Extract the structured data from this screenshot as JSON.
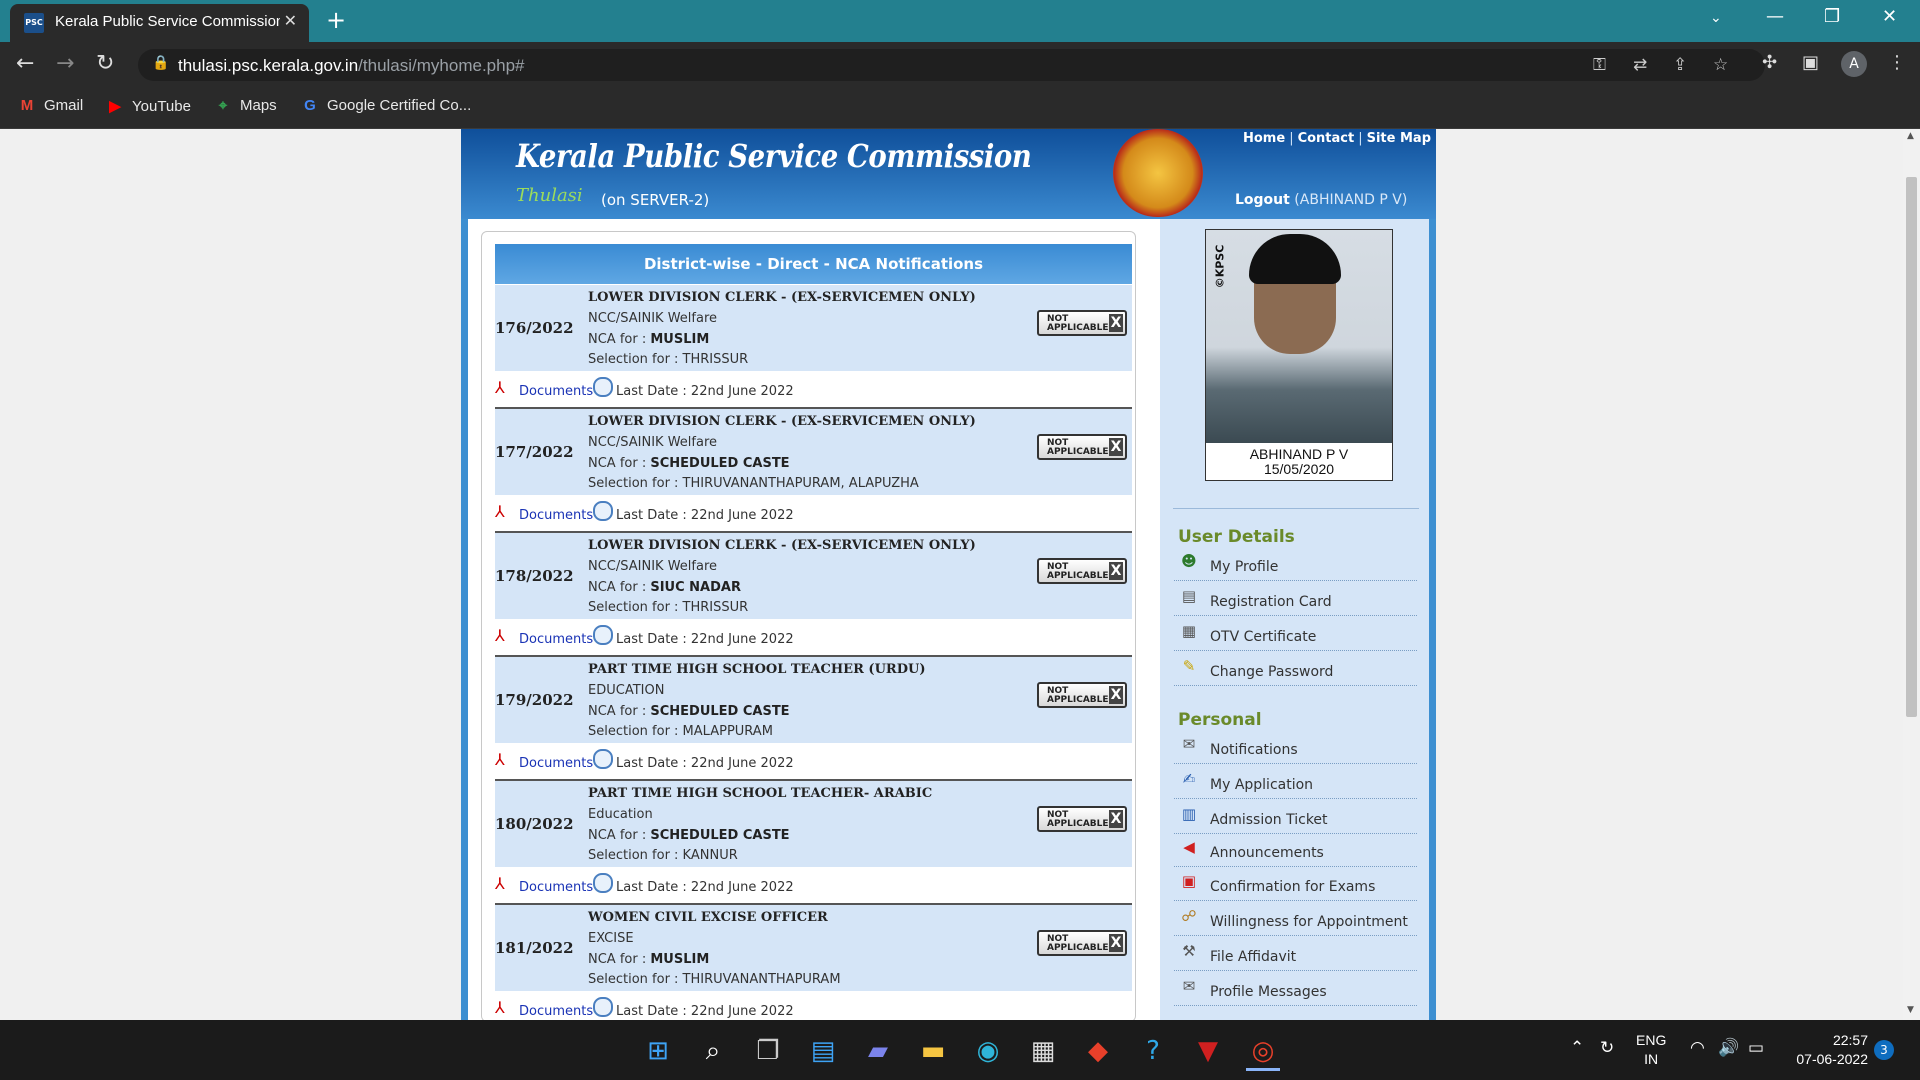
{
  "browser": {
    "tab_title": "Kerala Public Service Commission",
    "tab_favicon": "PSC",
    "url_domain": "thulasi.psc.kerala.gov.in",
    "url_path": "/thulasi/myhome.php#",
    "avatar_letter": "A",
    "bookmarks": [
      {
        "label": "Gmail",
        "icon": "gmail-icon"
      },
      {
        "label": "YouTube",
        "icon": "youtube-icon"
      },
      {
        "label": "Maps",
        "icon": "maps-icon"
      },
      {
        "label": "Google Certified Co...",
        "icon": "google-icon"
      }
    ]
  },
  "site": {
    "title": "Kerala Public Service Commission",
    "brand": "Thulasi",
    "server": "(on SERVER-2)",
    "links": [
      "Home",
      "Contact",
      "Site Map"
    ],
    "logout_label": "Logout",
    "logout_user": "(ABHINAND P V)"
  },
  "main": {
    "heading": "District-wise - Direct - NCA Notifications",
    "notifications": [
      {
        "number": "176/2022",
        "post": "LOWER DIVISION CLERK - (EX-SERVICEMEN ONLY)",
        "dept": "NCC/SAINIK Welfare",
        "nca_label": "NCA for : ",
        "nca": "MUSLIM",
        "selection": "Selection for : THRISSUR",
        "status1": "NOT",
        "status2": "APPLICABLE",
        "docs": "Documents",
        "last_date": "Last Date : 22nd June 2022"
      },
      {
        "number": "177/2022",
        "post": "LOWER DIVISION CLERK - (EX-SERVICEMEN ONLY)",
        "dept": "NCC/SAINIK Welfare",
        "nca_label": "NCA for : ",
        "nca": "SCHEDULED CASTE",
        "selection": "Selection for : THIRUVANANTHAPURAM, ALAPUZHA",
        "status1": "NOT",
        "status2": "APPLICABLE",
        "docs": "Documents",
        "last_date": "Last Date : 22nd June 2022"
      },
      {
        "number": "178/2022",
        "post": "LOWER DIVISION CLERK - (EX-SERVICEMEN ONLY)",
        "dept": "NCC/SAINIK Welfare",
        "nca_label": "NCA for : ",
        "nca": "SIUC NADAR",
        "selection": "Selection for : THRISSUR",
        "status1": "NOT",
        "status2": "APPLICABLE",
        "docs": "Documents",
        "last_date": "Last Date : 22nd June 2022"
      },
      {
        "number": "179/2022",
        "post": "PART TIME HIGH SCHOOL TEACHER (URDU)",
        "dept": "EDUCATION",
        "nca_label": "NCA for : ",
        "nca": "SCHEDULED CASTE",
        "selection": "Selection for : MALAPPURAM",
        "status1": "NOT",
        "status2": "APPLICABLE",
        "docs": "Documents",
        "last_date": "Last Date : 22nd June 2022"
      },
      {
        "number": "180/2022",
        "post": "PART TIME HIGH SCHOOL TEACHER- ARABIC",
        "dept": "Education",
        "nca_label": "NCA for : ",
        "nca": "SCHEDULED CASTE",
        "selection": "Selection for : KANNUR",
        "status1": "NOT",
        "status2": "APPLICABLE",
        "docs": "Documents",
        "last_date": "Last Date : 22nd June 2022"
      },
      {
        "number": "181/2022",
        "post": "WOMEN CIVIL EXCISE OFFICER",
        "dept": "EXCISE",
        "nca_label": "NCA for : ",
        "nca": "MUSLIM",
        "selection": "Selection for : THIRUVANANTHAPURAM",
        "status1": "NOT",
        "status2": "APPLICABLE",
        "docs": "Documents",
        "last_date": "Last Date : 22nd June 2022"
      }
    ]
  },
  "sidebar": {
    "photo_watermark": "©KPSC",
    "user_name": "ABHINAND P V",
    "photo_date": "15/05/2020",
    "sections": [
      {
        "heading": "User Details",
        "items": [
          {
            "label": "My Profile",
            "icon": "user-icon"
          },
          {
            "label": "Registration Card",
            "icon": "card-icon"
          },
          {
            "label": "OTV Certificate",
            "icon": "certificate-icon"
          },
          {
            "label": "Change Password",
            "icon": "pencil-icon"
          }
        ]
      },
      {
        "heading": "Personal",
        "items": [
          {
            "label": "Notifications",
            "icon": "envelope-icon"
          },
          {
            "label": "My Application",
            "icon": "edit-icon"
          },
          {
            "label": "Admission Ticket",
            "icon": "ticket-icon"
          },
          {
            "label": "Announcements",
            "icon": "megaphone-icon"
          },
          {
            "label": "Confirmation for Exams",
            "icon": "calendar-icon"
          },
          {
            "label": "Willingness for Appointment",
            "icon": "handshake-icon"
          },
          {
            "label": "File Affidavit",
            "icon": "gavel-icon"
          },
          {
            "label": "Profile Messages",
            "icon": "message-icon"
          }
        ]
      }
    ]
  },
  "taskbar": {
    "lang1": "ENG",
    "lang2": "IN",
    "time": "22:57",
    "date": "07-06-2022",
    "badge": "3"
  }
}
